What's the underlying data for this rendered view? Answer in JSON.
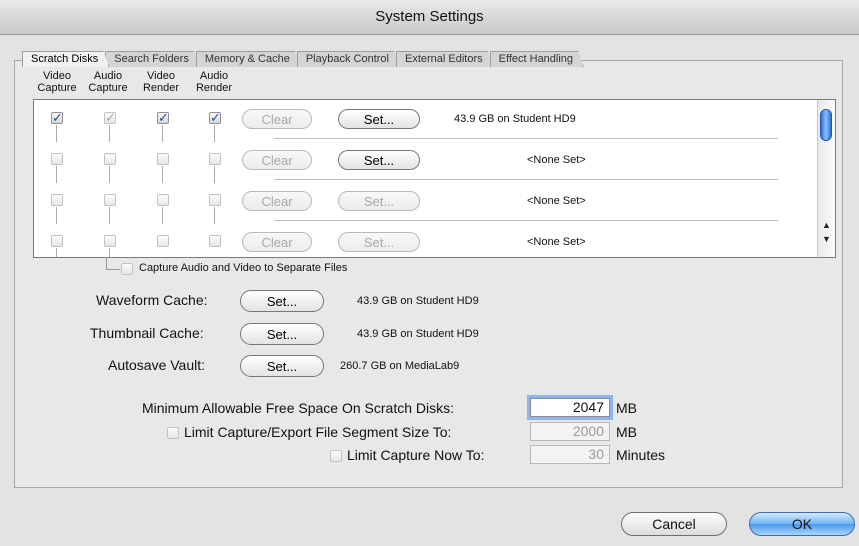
{
  "window": {
    "title": "System Settings"
  },
  "tabs": [
    "Scratch Disks",
    "Search Folders",
    "Memory & Cache",
    "Playback Control",
    "External Editors",
    "Effect Handling"
  ],
  "columns": [
    {
      "line1": "Video",
      "line2": "Capture"
    },
    {
      "line1": "Audio",
      "line2": "Capture"
    },
    {
      "line1": "Video",
      "line2": "Render"
    },
    {
      "line1": "Audio",
      "line2": "Render"
    }
  ],
  "scratch_rows": [
    {
      "checks": [
        true,
        true,
        true,
        true
      ],
      "clear": "Clear",
      "set": "Set...",
      "set_enabled": true,
      "info": "43.9 GB on Student HD9"
    },
    {
      "checks": [
        false,
        false,
        false,
        false
      ],
      "clear": "Clear",
      "set": "Set...",
      "set_enabled": true,
      "info": "<None Set>"
    },
    {
      "checks": [
        false,
        false,
        false,
        false
      ],
      "clear": "Clear",
      "set": "Set...",
      "set_enabled": false,
      "info": "<None Set>"
    },
    {
      "checks": [
        false,
        false,
        false,
        false
      ],
      "clear": "Clear",
      "set": "Set...",
      "set_enabled": false,
      "info": "<None Set>"
    }
  ],
  "separate_files": {
    "label": "Capture Audio and Video to Separate Files",
    "checked": false
  },
  "caches": [
    {
      "label": "Waveform Cache:",
      "button": "Set...",
      "info": "43.9 GB on Student HD9"
    },
    {
      "label": "Thumbnail Cache:",
      "button": "Set...",
      "info": "43.9 GB on Student HD9"
    },
    {
      "label": "Autosave Vault:",
      "button": "Set...",
      "info": "260.7 GB on MediaLab9"
    }
  ],
  "min_free": {
    "label": "Minimum Allowable Free Space On Scratch Disks:",
    "value": "2047",
    "unit": "MB"
  },
  "limit_segment": {
    "label": "Limit Capture/Export File Segment Size To:",
    "value": "2000",
    "unit": "MB",
    "checked": false
  },
  "limit_capture": {
    "label": "Limit Capture Now To:",
    "value": "30",
    "unit": "Minutes",
    "checked": false
  },
  "buttons": {
    "cancel": "Cancel",
    "ok": "OK"
  },
  "colors": {
    "accent": "#4c98e9",
    "checkmark": "#1a4fb5"
  }
}
